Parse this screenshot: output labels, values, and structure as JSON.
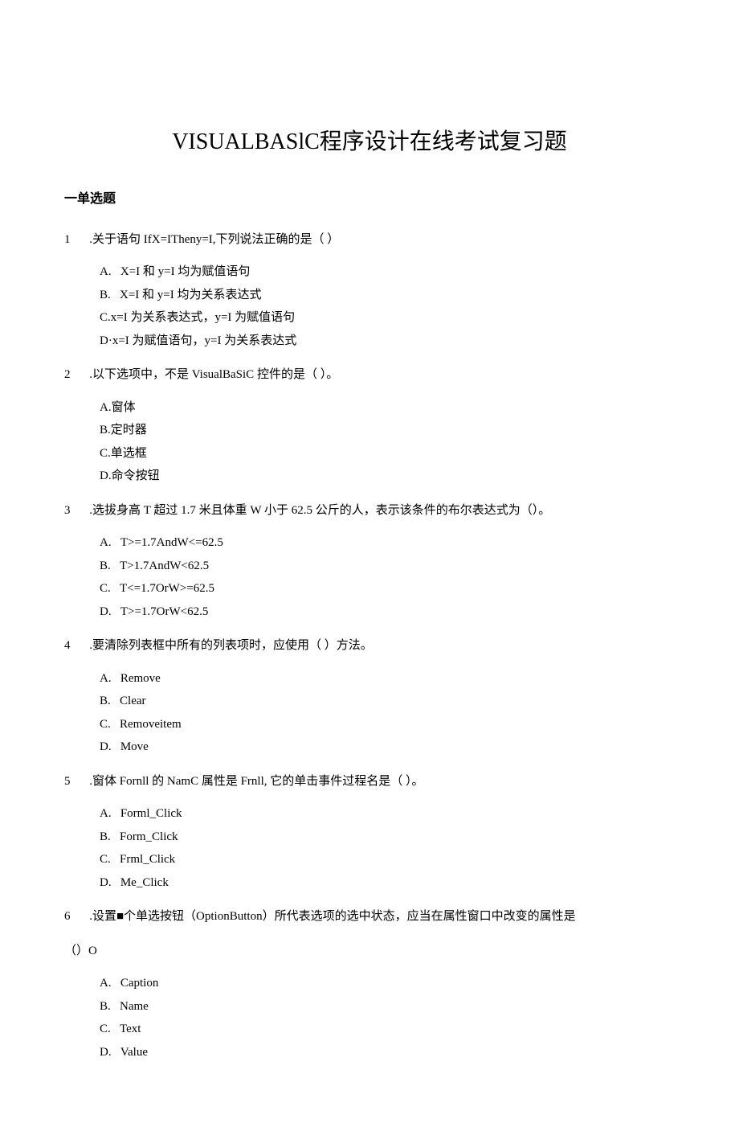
{
  "title": "VISUALBASlC程序设计在线考试复习题",
  "section_heading": "一单选题",
  "questions": [
    {
      "num": "1",
      "dot": "   .",
      "stem": "关于语句 IfX=ITheny=I,下列说法正确的是（                    ）",
      "options": [
        {
          "label": "A.   ",
          "text": "X=I 和 y=I 均为赋值语句"
        },
        {
          "label": "B.   ",
          "text": "X=I 和 y=I 均为关系表达式"
        },
        {
          "label": "C.",
          "text": "x=I 为关系表达式，y=I 为赋值语句"
        },
        {
          "label": "D·",
          "text": "x=I 为赋值语句，y=I 为关系表达式"
        }
      ]
    },
    {
      "num": "2",
      "dot": "   .",
      "stem": "以下选项中，不是 VisualBaSiC 控件的是（                    ）。",
      "options": [
        {
          "label": "A.",
          "text": "窗体"
        },
        {
          "label": "B.",
          "text": "定时器"
        },
        {
          "label": "C.",
          "text": "单选框"
        },
        {
          "label": "D.",
          "text": "命令按钮"
        }
      ]
    },
    {
      "num": "3",
      "dot": "   .",
      "stem": "选拔身高 T 超过 1.7 米且体重 W 小于 62.5 公斤的人，表示该条件的布尔表达式为（）。",
      "options": [
        {
          "label": "A.   ",
          "text": "T>=1.7AndW<=62.5"
        },
        {
          "label": "B.   ",
          "text": "T>1.7AndW<62.5"
        },
        {
          "label": "C.   ",
          "text": "T<=1.7OrW>=62.5"
        },
        {
          "label": "D.   ",
          "text": "T>=1.7OrW<62.5"
        }
      ]
    },
    {
      "num": "4",
      "dot": "   .",
      "stem": "要清除列表框中所有的列表项时，应使用（        ）方法。",
      "options": [
        {
          "label": "A.   ",
          "text": "Remove"
        },
        {
          "label": "B.   ",
          "text": "Clear"
        },
        {
          "label": "C.   ",
          "text": "Removeitem"
        },
        {
          "label": "D.   ",
          "text": "Move"
        }
      ]
    },
    {
      "num": "5",
      "dot": "   .",
      "stem": "窗体 Fornll 的 NamC 属性是 Frnll, 它的单击事件过程名是（                  ）。",
      "options": [
        {
          "label": "A.   ",
          "text": "Forml_Click"
        },
        {
          "label": "B.   ",
          "text": "Form_Click"
        },
        {
          "label": "C.   ",
          "text": "Frml_Click"
        },
        {
          "label": "D.   ",
          "text": "Me_Click"
        }
      ]
    },
    {
      "num": "6",
      "dot": "   .",
      "stem": "设置■个单选按钮（OptionButton）所代表选项的选中状态，应当在属性窗口中改变的属性是",
      "extra": "（）O",
      "options": [
        {
          "label": "A.   ",
          "text": "Caption"
        },
        {
          "label": "B.   ",
          "text": "Name"
        },
        {
          "label": "C.   ",
          "text": "Text"
        },
        {
          "label": "D.   ",
          "text": "Value"
        }
      ]
    }
  ]
}
